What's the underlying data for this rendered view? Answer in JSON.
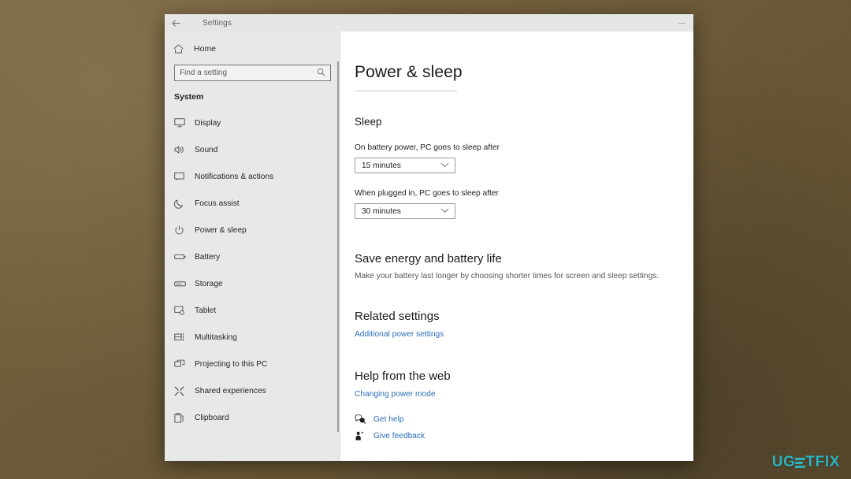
{
  "desktop": {
    "background_color": "#6d5b39"
  },
  "window": {
    "titlebar": {
      "back_icon": "back-arrow-icon",
      "title": "Settings",
      "minimize_label": "—"
    }
  },
  "sidebar": {
    "home": {
      "icon": "home-icon",
      "label": "Home"
    },
    "search": {
      "icon": "search-icon",
      "placeholder": "Find a setting",
      "value": ""
    },
    "section_header": "System",
    "items": [
      {
        "icon": "monitor-icon",
        "label": "Display"
      },
      {
        "icon": "speaker-icon",
        "label": "Sound"
      },
      {
        "icon": "notification-icon",
        "label": "Notifications & actions"
      },
      {
        "icon": "moon-icon",
        "label": "Focus assist"
      },
      {
        "icon": "power-icon",
        "label": "Power & sleep"
      },
      {
        "icon": "battery-icon",
        "label": "Battery"
      },
      {
        "icon": "storage-icon",
        "label": "Storage"
      },
      {
        "icon": "tablet-icon",
        "label": "Tablet"
      },
      {
        "icon": "multitasking-icon",
        "label": "Multitasking"
      },
      {
        "icon": "projecting-icon",
        "label": "Projecting to this PC"
      },
      {
        "icon": "shared-icon",
        "label": "Shared experiences"
      },
      {
        "icon": "clipboard-icon",
        "label": "Clipboard"
      }
    ]
  },
  "content": {
    "page_title": "Power & sleep",
    "sleep": {
      "group_title": "Sleep",
      "battery_label": "On battery power, PC goes to sleep after",
      "battery_value": "15 minutes",
      "plugged_label": "When plugged in, PC goes to sleep after",
      "plugged_value": "30 minutes",
      "chevron_icon": "chevron-down-icon"
    },
    "save_energy": {
      "heading": "Save energy and battery life",
      "description": "Make your battery last longer by choosing shorter times for screen and sleep settings."
    },
    "related": {
      "heading": "Related settings",
      "link": "Additional power settings"
    },
    "help": {
      "heading": "Help from the web",
      "link": "Changing power mode",
      "get_help": {
        "icon": "get-help-icon",
        "label": "Get help"
      },
      "give_feedback": {
        "icon": "feedback-icon",
        "label": "Give feedback"
      }
    }
  },
  "watermark": {
    "part1": "UG",
    "part2": "TFIX",
    "teal": "#2bb3c0"
  }
}
